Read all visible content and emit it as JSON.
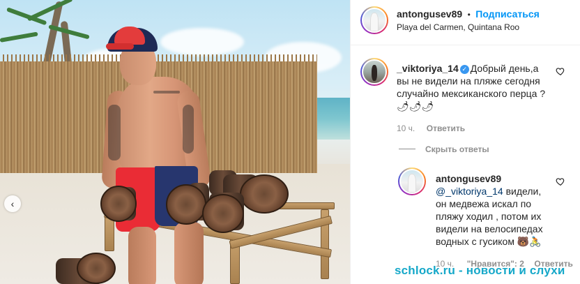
{
  "post": {
    "author": "antongusev89",
    "follow_label": "Подписаться",
    "separator": "•",
    "location": "Playa del Carmen, Quintana Roo"
  },
  "comments": [
    {
      "username": "_viktoriya_14",
      "verified": true,
      "text": "Добрый день,а вы не видели на пляже сегодня случайно мексиканского перца ?🌶🌶🌶",
      "time": "10 ч.",
      "reply_label": "Ответить",
      "hide_replies_label": "Скрыть ответы",
      "replies": [
        {
          "username": "antongusev89",
          "mention": "@_viktoriya_14",
          "text": " видели, он медвежа искал по пляжу ходил , потом их видели на велосипедах водных с гусиком 🐻🚴",
          "time": "10 ч.",
          "likes_label": "\"Нравится\": 2",
          "reply_label": "Ответить"
        }
      ]
    }
  ],
  "watermark": "schlock.ru - новости и слухи",
  "icons": [
    "heart-icon",
    "chevron-left-icon",
    "verified-icon"
  ],
  "colors": {
    "follow": "#0095f6",
    "mention": "#00376b",
    "meta": "#8e8e8e",
    "watermark": "#16a8c9"
  }
}
